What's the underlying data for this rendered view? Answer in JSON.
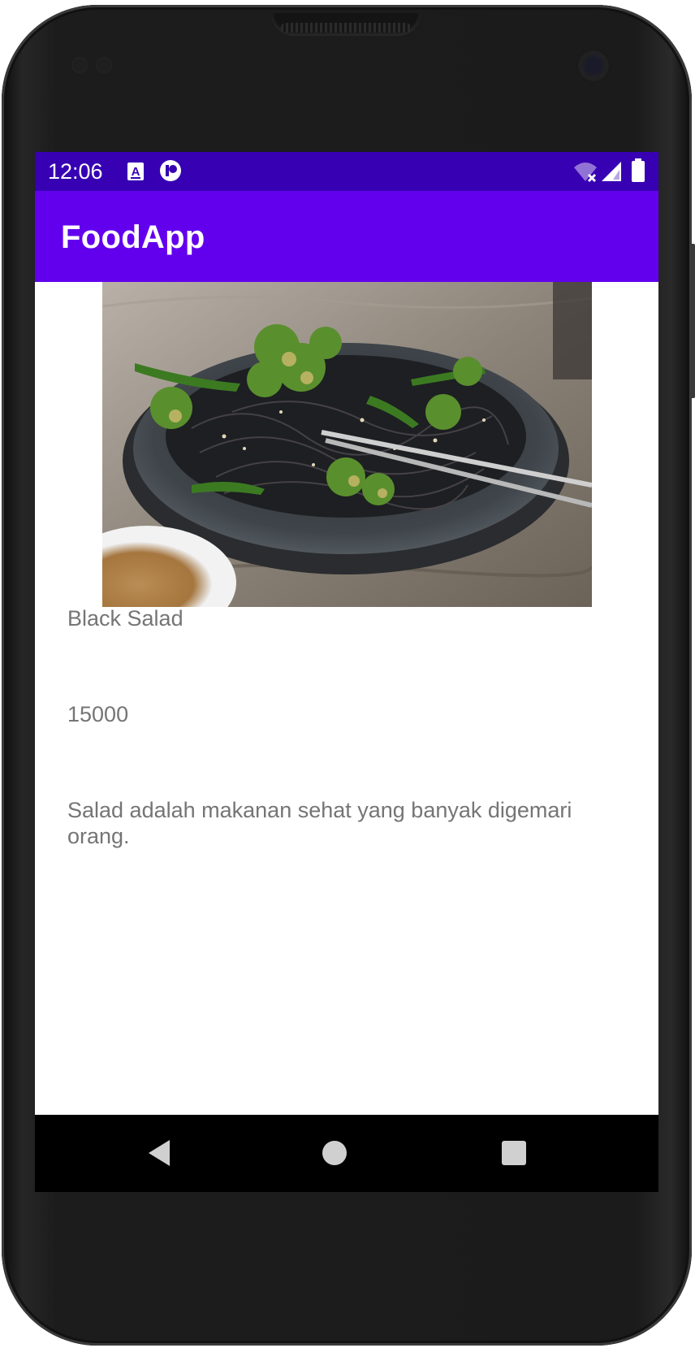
{
  "status_bar": {
    "time": "12:06"
  },
  "app_bar": {
    "title": "FoodApp"
  },
  "food": {
    "name": "Black Salad",
    "price": "15000",
    "description": "Salad adalah makanan sehat yang banyak digemari orang."
  },
  "colors": {
    "status_bar": "#3700b3",
    "app_bar": "#6200ee",
    "detail_text": "#757575",
    "nav_bar": "#000000"
  },
  "icons": {
    "status_left": [
      "a-notification-icon",
      "sync-app-icon"
    ],
    "status_right": [
      "wifi-off-icon",
      "cell-signal-icon",
      "battery-icon"
    ],
    "nav": [
      "back-icon",
      "home-icon",
      "recents-icon"
    ]
  }
}
